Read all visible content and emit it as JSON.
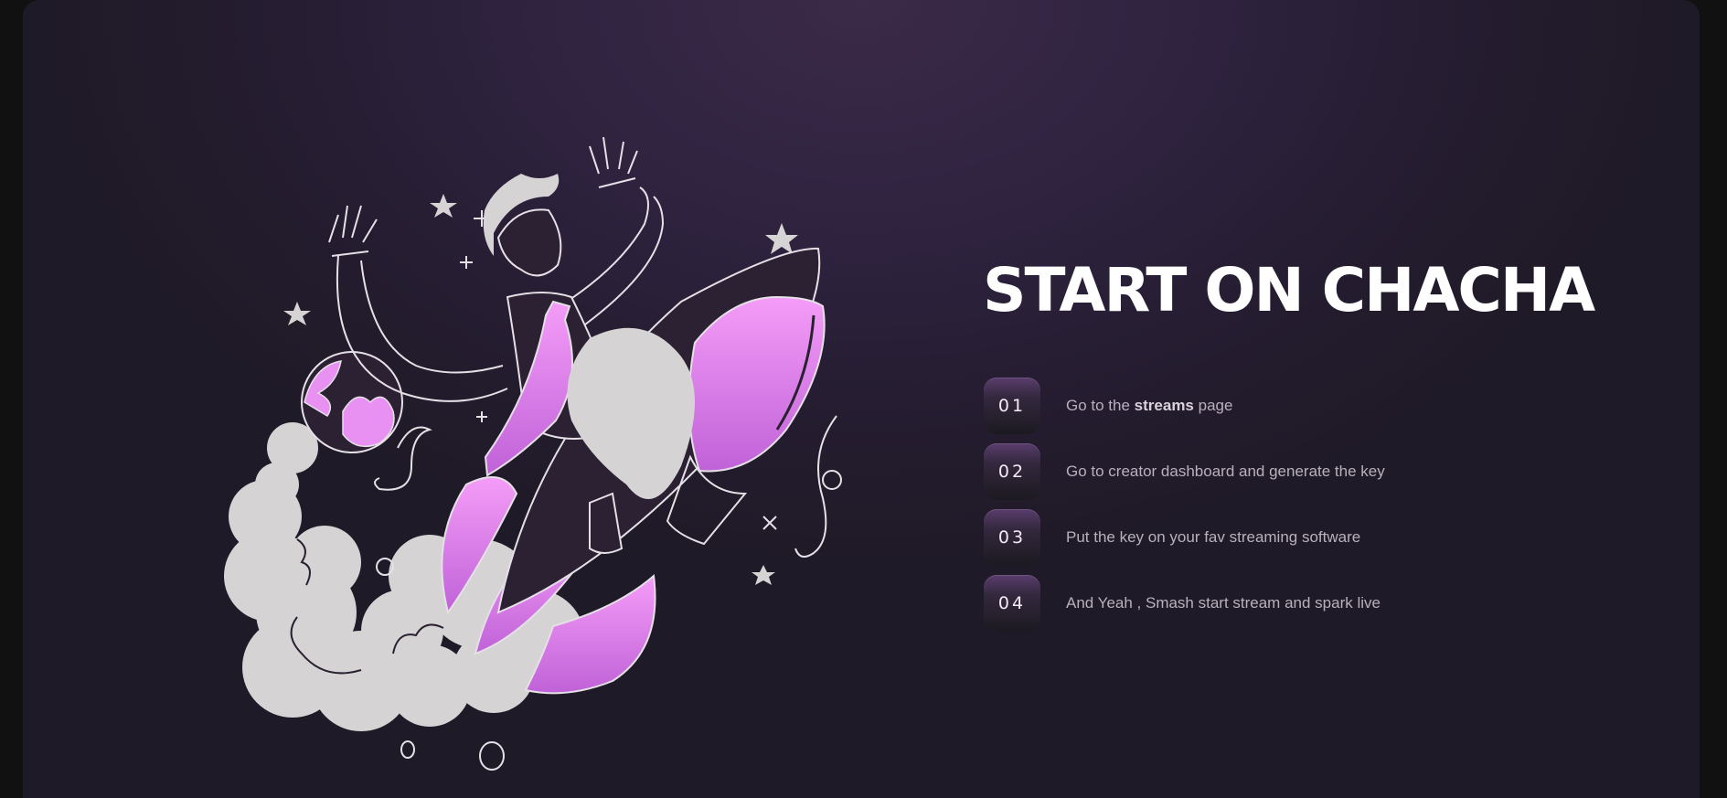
{
  "hero": {
    "title": "START ON CHACHA"
  },
  "steps": [
    {
      "number": "01",
      "text_before": "Go to the ",
      "text_bold": "streams",
      "text_after": " page"
    },
    {
      "number": "02",
      "text": "Go to creator dashboard and generate the key"
    },
    {
      "number": "03",
      "text": "Put the key on your fav streaming software"
    },
    {
      "number": "04",
      "text": "And Yeah , Smash start stream and spark live"
    }
  ],
  "illustration": {
    "icon": "astronaut-rocket-illustration",
    "colors": {
      "accent": "#e991f2",
      "accent_dark": "#c062d8",
      "smoke": "#d6d3d4",
      "line": "#e4e0e6"
    }
  }
}
